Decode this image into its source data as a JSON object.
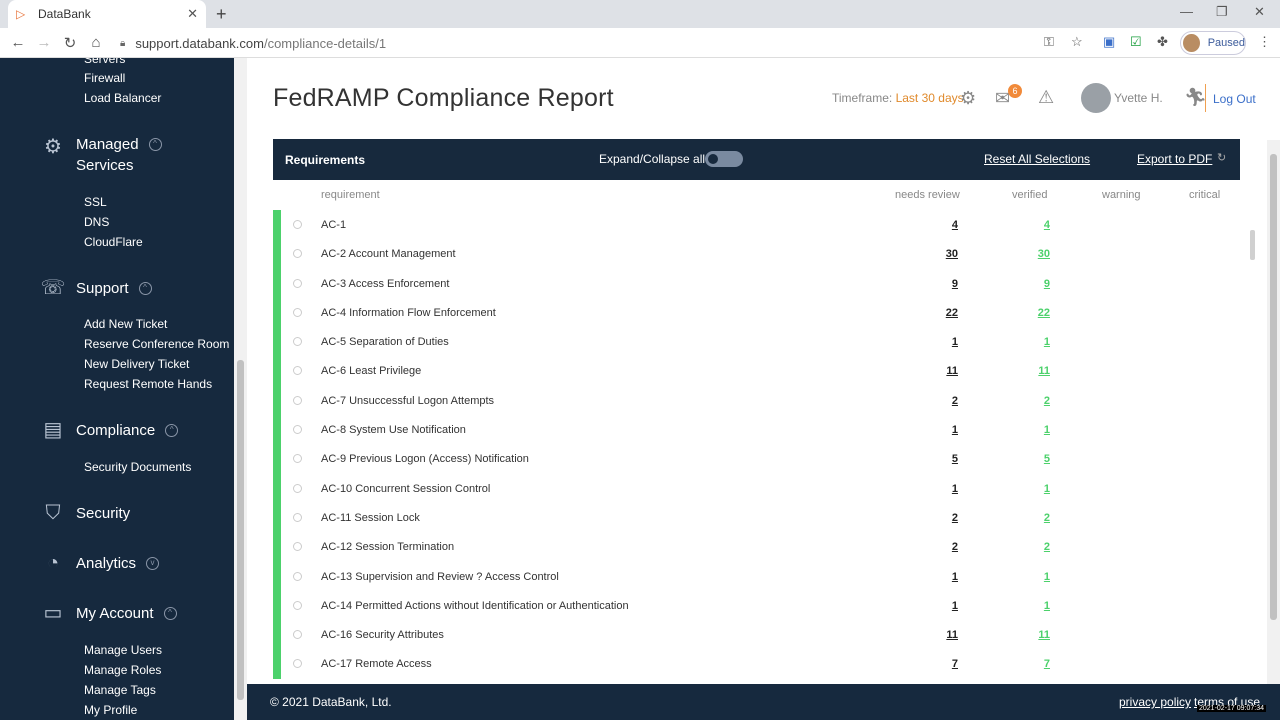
{
  "browser": {
    "tab_title": "DataBank",
    "url_host": "support.databank.com",
    "url_path": "/compliance-details/1",
    "profile_label": "Paused"
  },
  "sidebar": {
    "top_items": [
      "Servers",
      "Firewall",
      "Load Balancer"
    ],
    "sections": [
      {
        "label": "Managed\nServices",
        "icon": "gears-icon",
        "items": [
          "SSL",
          "DNS",
          "CloudFlare"
        ]
      },
      {
        "label": "Support",
        "icon": "chat-bubbles-icon",
        "items": [
          "Add New Ticket",
          "Reserve Conference Room",
          "New Delivery Ticket",
          "Request Remote Hands"
        ]
      },
      {
        "label": "Compliance",
        "icon": "document-icon",
        "items": [
          "Security Documents"
        ]
      },
      {
        "label": "Security",
        "icon": "shield-icon",
        "items": []
      },
      {
        "label": "Analytics",
        "icon": "pie-chart-icon",
        "items": []
      },
      {
        "label": "My Account",
        "icon": "id-card-icon",
        "items": [
          "Manage Users",
          "Manage Roles",
          "Manage Tags",
          "My Profile"
        ]
      }
    ]
  },
  "header": {
    "page_title": "FedRAMP Compliance Report",
    "timeframe_label": "Timeframe:",
    "timeframe_value": "Last 30 days",
    "mail_badge": "6",
    "user_name": "Yvette H.",
    "logout_label": "Log Out"
  },
  "table": {
    "header_title": "Requirements",
    "expand_label": "Expand/Collapse all",
    "reset_label": "Reset All Selections",
    "export_label": "Export to PDF",
    "columns": [
      "requirement",
      "needs review",
      "verified",
      "warning",
      "critical"
    ],
    "rows": [
      {
        "name": "AC-1",
        "needs_review": "4",
        "verified": "4"
      },
      {
        "name": "AC-2 Account Management",
        "needs_review": "30",
        "verified": "30"
      },
      {
        "name": "AC-3 Access Enforcement",
        "needs_review": "9",
        "verified": "9"
      },
      {
        "name": "AC-4 Information Flow Enforcement",
        "needs_review": "22",
        "verified": "22"
      },
      {
        "name": "AC-5 Separation of Duties",
        "needs_review": "1",
        "verified": "1"
      },
      {
        "name": "AC-6 Least Privilege",
        "needs_review": "11",
        "verified": "11"
      },
      {
        "name": "AC-7 Unsuccessful Logon Attempts",
        "needs_review": "2",
        "verified": "2"
      },
      {
        "name": "AC-8 System Use Notification",
        "needs_review": "1",
        "verified": "1"
      },
      {
        "name": "AC-9 Previous Logon (Access) Notification",
        "needs_review": "5",
        "verified": "5"
      },
      {
        "name": "AC-10 Concurrent Session Control",
        "needs_review": "1",
        "verified": "1"
      },
      {
        "name": "AC-11 Session Lock",
        "needs_review": "2",
        "verified": "2"
      },
      {
        "name": "AC-12 Session Termination",
        "needs_review": "2",
        "verified": "2"
      },
      {
        "name": "AC-13 Supervision and Review ? Access Control",
        "needs_review": "1",
        "verified": "1"
      },
      {
        "name": "AC-14 Permitted Actions without Identification or Authentication",
        "needs_review": "1",
        "verified": "1"
      },
      {
        "name": "AC-16 Security Attributes",
        "needs_review": "11",
        "verified": "11"
      },
      {
        "name": "AC-17 Remote Access",
        "needs_review": "7",
        "verified": "7"
      }
    ]
  },
  "footer": {
    "copyright": "© 2021 DataBank, Ltd.",
    "privacy": "privacy policy",
    "terms": "terms of use",
    "timestamp": "2021-02-17 09:07:34"
  },
  "colors": {
    "sidebar_bg": "#16293e",
    "accent_green": "#4cd16b",
    "accent_orange": "#e08a2c",
    "link_blue": "#3b6fc9"
  }
}
